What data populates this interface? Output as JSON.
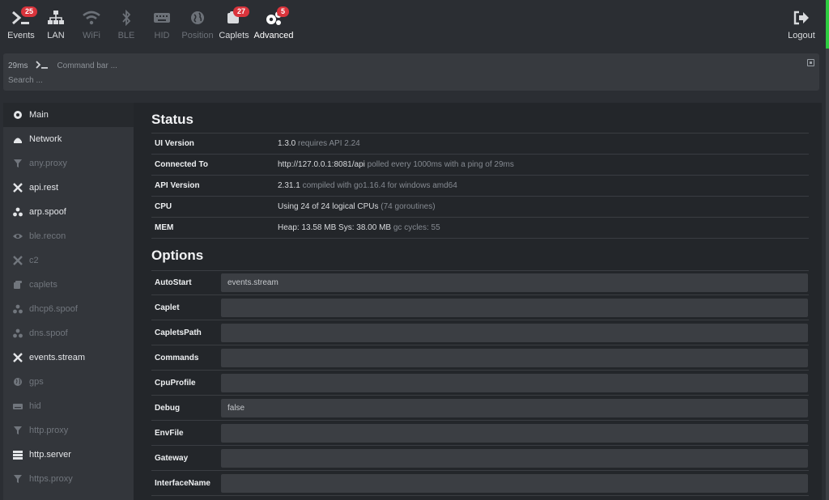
{
  "nav": {
    "items": [
      {
        "label": "Events",
        "badge": "25",
        "icon": "terminal-icon"
      },
      {
        "label": "LAN",
        "badge": "",
        "icon": "network-icon"
      },
      {
        "label": "WiFi",
        "badge": "",
        "icon": "wifi-icon"
      },
      {
        "label": "BLE",
        "badge": "",
        "icon": "bluetooth-icon"
      },
      {
        "label": "HID",
        "badge": "",
        "icon": "keyboard-icon"
      },
      {
        "label": "Position",
        "badge": "",
        "icon": "globe-icon"
      },
      {
        "label": "Caplets",
        "badge": "27",
        "icon": "scroll-icon"
      },
      {
        "label": "Advanced",
        "badge": "5",
        "icon": "gears-icon"
      }
    ],
    "logout": "Logout"
  },
  "command": {
    "latency": "29ms",
    "placeholder": "Command bar ...",
    "search_placeholder": "Search ..."
  },
  "sidebar": {
    "items": [
      {
        "label": "Main",
        "icon": "gear-icon",
        "state": "active"
      },
      {
        "label": "Network",
        "icon": "network-icon",
        "state": "on"
      },
      {
        "label": "any.proxy",
        "icon": "filter-icon",
        "state": "off"
      },
      {
        "label": "api.rest",
        "icon": "tools-icon",
        "state": "on"
      },
      {
        "label": "arp.spoof",
        "icon": "radiation-icon",
        "state": "on"
      },
      {
        "label": "ble.recon",
        "icon": "eye-icon",
        "state": "off"
      },
      {
        "label": "c2",
        "icon": "tools-icon",
        "state": "off"
      },
      {
        "label": "caplets",
        "icon": "scroll-icon",
        "state": "off"
      },
      {
        "label": "dhcp6.spoof",
        "icon": "radiation-icon",
        "state": "off"
      },
      {
        "label": "dns.spoof",
        "icon": "radiation-icon",
        "state": "off"
      },
      {
        "label": "events.stream",
        "icon": "tools-icon",
        "state": "on"
      },
      {
        "label": "gps",
        "icon": "globe-icon",
        "state": "off"
      },
      {
        "label": "hid",
        "icon": "keyboard-icon",
        "state": "off"
      },
      {
        "label": "http.proxy",
        "icon": "filter-icon",
        "state": "off"
      },
      {
        "label": "http.server",
        "icon": "server-icon",
        "state": "on"
      },
      {
        "label": "https.proxy",
        "icon": "filter-icon",
        "state": "off"
      }
    ]
  },
  "status": {
    "title": "Status",
    "rows": [
      {
        "key": "UI Version",
        "value": "1.3.0",
        "meta": " requires API 2.24"
      },
      {
        "key": "Connected To",
        "value": "http://127.0.0.1:8081/api",
        "meta": " polled every 1000ms with a ping of 29ms"
      },
      {
        "key": "API Version",
        "value": "2.31.1",
        "meta": " compiled with go1.16.4 for windows amd64"
      },
      {
        "key": "CPU",
        "value": "Using 24 of 24 logical CPUs",
        "meta": " (74 goroutines)"
      },
      {
        "key": "MEM",
        "value": "Heap: 13.58 MB Sys: 38.00 MB",
        "meta": " gc cycles: 55"
      }
    ]
  },
  "options": {
    "title": "Options",
    "rows": [
      {
        "key": "AutoStart",
        "value": "events.stream"
      },
      {
        "key": "Caplet",
        "value": ""
      },
      {
        "key": "CapletsPath",
        "value": ""
      },
      {
        "key": "Commands",
        "value": ""
      },
      {
        "key": "CpuProfile",
        "value": ""
      },
      {
        "key": "Debug",
        "value": "false"
      },
      {
        "key": "EnvFile",
        "value": ""
      },
      {
        "key": "Gateway",
        "value": ""
      },
      {
        "key": "InterfaceName",
        "value": ""
      }
    ]
  }
}
